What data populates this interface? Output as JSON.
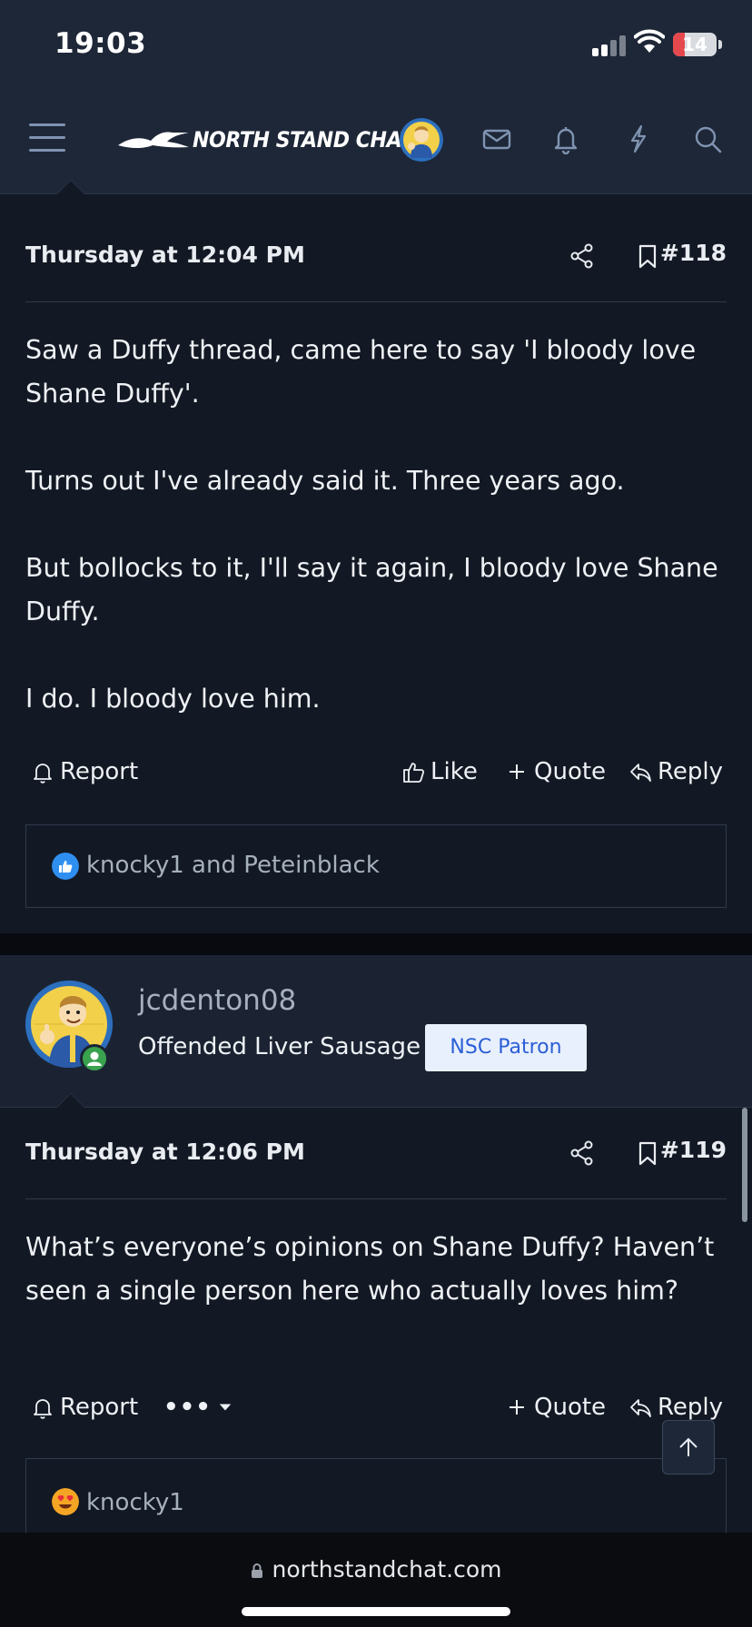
{
  "status_bar": {
    "time": "19:03",
    "battery": "14",
    "battery_level": 0.14
  },
  "header": {
    "site_name": "NORTH STAND CHAT",
    "icons": [
      "menu-icon",
      "mail-icon",
      "bell-icon",
      "bolt-icon",
      "search-icon"
    ]
  },
  "posts": [
    {
      "date": "Thursday at 12:04 PM",
      "number": "#118",
      "body": [
        "Saw a Duffy thread, came here to say 'I bloody love Shane Duffy'.",
        "Turns out I've already said it. Three years ago.",
        "But bollocks to it, I'll say it again, I bloody love Shane Duffy.",
        "I do. I bloody love him."
      ],
      "actions": {
        "report": "Report",
        "like": "Like",
        "quote": "Quote",
        "reply": "Reply"
      },
      "reactions": {
        "icon": "thumbs-up-reaction",
        "text": "knocky1 and Peteinblack"
      }
    },
    {
      "author": {
        "username": "jcdenton08",
        "title": "Offended Liver Sausage",
        "banner": "NSC Patron",
        "status": "online"
      },
      "date": "Thursday at 12:06 PM",
      "number": "#119",
      "body": [
        "What’s everyone’s opinions on Shane Duffy? Haven’t seen a single person here who actually loves him?"
      ],
      "actions": {
        "report": "Report",
        "more": "•••",
        "quote": "Quote",
        "reply": "Reply"
      },
      "reactions": {
        "icon": "heart-eyes-reaction",
        "text": "knocky1"
      }
    }
  ],
  "browser": {
    "url": "northstandchat.com"
  },
  "colors": {
    "background": "#131924",
    "header": "#1e2737",
    "accent": "#7f93b1",
    "banner_text": "#2b5fd6",
    "online": "#3aa24f"
  }
}
